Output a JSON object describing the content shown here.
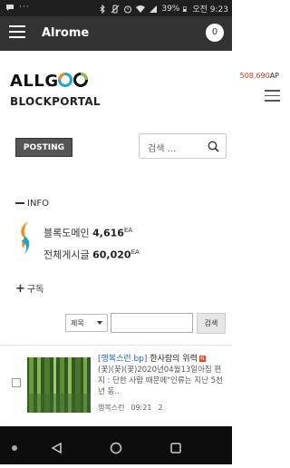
{
  "status_bar": {
    "left_icons": [
      "chat-bubble-icon",
      "dots-icon"
    ],
    "right_icons": [
      "bluetooth-icon",
      "silent-icon",
      "alarm-icon",
      "wifi-icon",
      "signal-icon",
      "battery-icon"
    ],
    "battery": "39%",
    "time": "오전 9:23"
  },
  "app_bar": {
    "title": "Alrome",
    "badge_count": "0",
    "menu_icon": "hamburger-menu-icon"
  },
  "site": {
    "logo_text": "ALLGOO",
    "logo_sub": "BLOCKPORTAL",
    "points_value": "508,690",
    "points_unit": "AP"
  },
  "toolbar": {
    "posting_label": "POSTING",
    "search_placeholder": "검색 ..."
  },
  "info": {
    "heading": "INFO",
    "domain_label": "블록도메인",
    "domain_count": "4,616",
    "domain_unit": "EA",
    "posts_label": "전체게시글",
    "posts_count": "60,020",
    "posts_unit": "EA"
  },
  "subscribe": {
    "label": "구독"
  },
  "filter": {
    "select_value": "제목",
    "search_button": "검색"
  },
  "posts": [
    {
      "tag": "[행복스런.bp]",
      "title": "한사람의 위력",
      "new_badge": "N",
      "body": "(꽃)(꽃)(꽃)2020년04월13일아침 편지 : 단한 사람 때문에\"인류는 지난 5천 년 동..",
      "author": "행복스런",
      "time": "09:21",
      "comments": "2"
    }
  ],
  "colors": {
    "app_bar": "#333333",
    "points": "#d23a1e",
    "tag_link": "#2a62b8",
    "new_badge": "#e24a1d"
  }
}
